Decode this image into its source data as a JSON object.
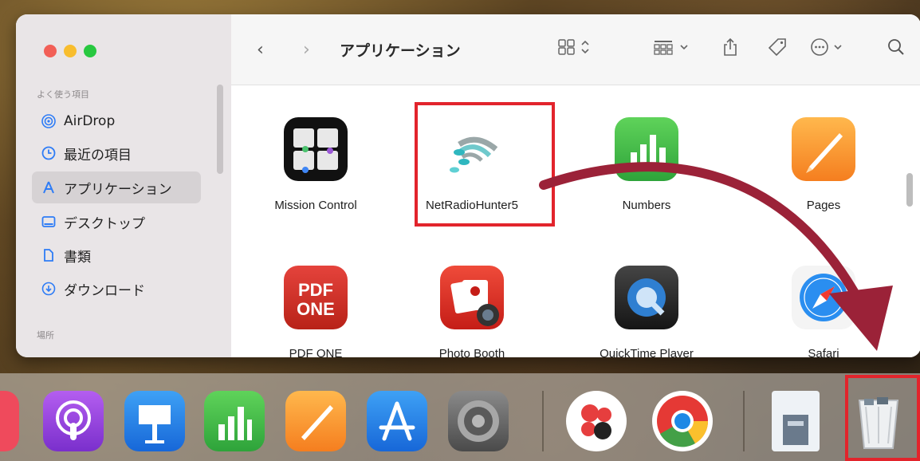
{
  "sidebar": {
    "favorites_heading": "よく使う項目",
    "items": [
      {
        "label": "AirDrop",
        "icon": "airdrop-icon"
      },
      {
        "label": "最近の項目",
        "icon": "clock-icon"
      },
      {
        "label": "アプリケーション",
        "icon": "applications-icon",
        "selected": true
      },
      {
        "label": "デスクトップ",
        "icon": "desktop-icon"
      },
      {
        "label": "書類",
        "icon": "document-icon"
      },
      {
        "label": "ダウンロード",
        "icon": "download-icon"
      }
    ],
    "locations_heading": "場所"
  },
  "toolbar": {
    "title": "アプリケーション",
    "back": "‹",
    "forward": "›"
  },
  "apps": [
    {
      "label": "Mission Control",
      "icon": "mission-control-icon"
    },
    {
      "label": "NetRadioHunter5",
      "icon": "netradiohunter-icon",
      "highlighted": true
    },
    {
      "label": "Numbers",
      "icon": "numbers-icon"
    },
    {
      "label": "Pages",
      "icon": "pages-icon"
    },
    {
      "label": "PDF ONE",
      "icon": "pdf-one-icon",
      "icon_text": "PDF\nONE"
    },
    {
      "label": "Photo Booth",
      "icon": "photo-booth-icon"
    },
    {
      "label": "QuickTime Player",
      "icon": "quicktime-icon"
    },
    {
      "label": "Safari",
      "icon": "safari-icon"
    }
  ],
  "dock": [
    "podcasts-icon",
    "keynote-icon",
    "numbers-icon",
    "pages-icon",
    "app-store-icon",
    "system-preferences-icon",
    "dock-app-icon",
    "chrome-icon",
    "finder-doc-icon",
    "trash-icon"
  ],
  "colors": {
    "highlight": "#e2242c",
    "arrow": "#9b2238"
  }
}
